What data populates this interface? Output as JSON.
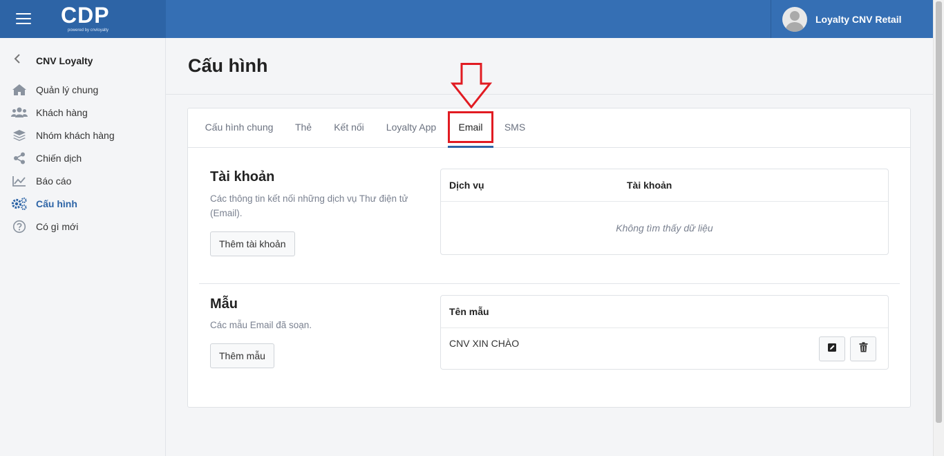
{
  "header": {
    "logo": "CDP",
    "logo_sub": "powered by cnvloyalty",
    "user_name": "Loyalty CNV Retail"
  },
  "sidebar": {
    "back_label": "CNV Loyalty",
    "items": [
      {
        "label": "Quản lý chung",
        "icon": "home-icon"
      },
      {
        "label": "Khách hàng",
        "icon": "users-icon"
      },
      {
        "label": "Nhóm khách hàng",
        "icon": "layers-icon"
      },
      {
        "label": "Chiến dịch",
        "icon": "share-icon"
      },
      {
        "label": "Báo cáo",
        "icon": "chart-line-icon"
      },
      {
        "label": "Cấu hình",
        "icon": "gears-icon",
        "active": true
      },
      {
        "label": "Có gì mới",
        "icon": "question-circle-icon"
      }
    ]
  },
  "page": {
    "title": "Cấu hình"
  },
  "tabs": [
    {
      "label": "Cấu hình chung"
    },
    {
      "label": "Thẻ"
    },
    {
      "label": "Kết nối"
    },
    {
      "label": "Loyalty App"
    },
    {
      "label": "Email",
      "active": true
    },
    {
      "label": "SMS"
    }
  ],
  "account_section": {
    "title": "Tài khoản",
    "description": "Các thông tin kết nối những dịch vụ Thư điện tử (Email).",
    "add_button": "Thêm tài khoản",
    "table": {
      "columns": [
        "Dịch vụ",
        "Tài khoản"
      ],
      "empty_text": "Không tìm thấy dữ liệu"
    }
  },
  "template_section": {
    "title": "Mẫu",
    "description": "Các mẫu Email đã soạn.",
    "add_button": "Thêm mẫu",
    "table": {
      "columns": [
        "Tên mẫu"
      ],
      "rows": [
        {
          "name": "CNV XIN CHÀO"
        }
      ]
    }
  },
  "colors": {
    "topbar": "#356fb4",
    "accent": "#2d64a6",
    "annotation": "#e11b22"
  }
}
